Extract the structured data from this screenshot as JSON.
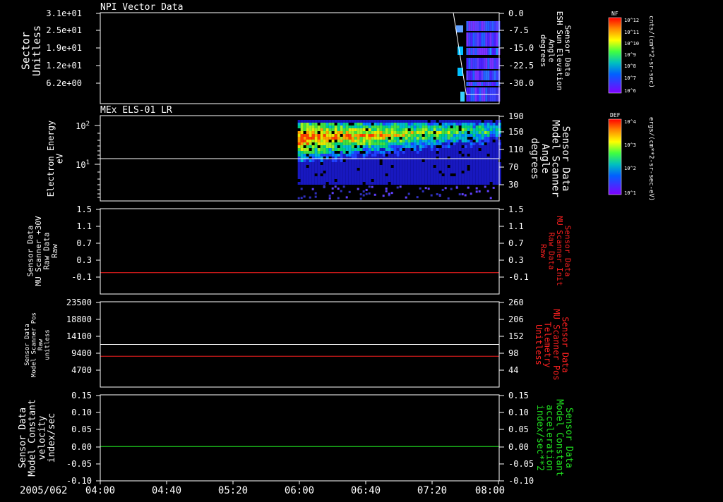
{
  "chart_data": [
    {
      "type": "heatmap",
      "title": "NPI Vector Data",
      "ylabel": "Sector\nUnitless",
      "yticks": [
        "3.1e+01",
        "2.5e+01",
        "1.9e+01",
        "1.2e+01",
        "6.2e+00"
      ],
      "y2label": "Sensor Data\nESH Sun Elevation\nAngle\ndegrees",
      "y2ticks": [
        "0.0",
        "-7.5",
        "-15.0",
        "-22.5",
        "-30.0"
      ],
      "y2lim": [
        -34.5,
        0
      ],
      "colorbar_label": "NF",
      "colorbar_units": "cnts/(cm**2-sr-sec)",
      "colorbar_ticks": [
        "10^12",
        "10^11",
        "10^10",
        "10^9",
        "10^8",
        "10^7",
        "10^6"
      ],
      "angle_series": {
        "x": [
          0,
          3.54,
          3.67,
          4.0
        ],
        "y": [
          0,
          0,
          -31,
          -31
        ]
      },
      "data_start_hour": 3.67
    },
    {
      "type": "heatmap",
      "title": "MEx ELS-01 LR",
      "ylabel": "Electron Energy\neV",
      "yticks": [
        "10^2",
        "10^1"
      ],
      "y2label": "Sensor Data\nModel Scanner\nAngle\ndegrees",
      "y2ticks": [
        "190",
        "150",
        "110",
        "70",
        "30"
      ],
      "y2lim": [
        0,
        190
      ],
      "colorbar_label": "DEF",
      "colorbar_units": "ergs/(cm**2-sr-sec-eV)",
      "colorbar_ticks": [
        "10^4",
        "10^3",
        "10^2",
        "10^1"
      ],
      "angle_series": {
        "x": [
          0,
          4.0
        ],
        "y": [
          90,
          90
        ]
      },
      "data_start_hour": 1.98
    },
    {
      "type": "line",
      "ylabel": "Sensor Data\nMU Scanner +30V\nRaw Data\nRaw",
      "yticks": [
        "1.5",
        "1.1",
        "0.7",
        "0.3",
        "-0.1"
      ],
      "ylim": [
        -0.5,
        1.5
      ],
      "y2label": "Sensor Data\nMU Scanner Init\nRaw Data\nRaw",
      "y2ticks": [
        "1.5",
        "1.1",
        "0.7",
        "0.3",
        "-0.1"
      ],
      "series": [
        {
          "values": [
            0,
            0
          ],
          "color": "#ff2020"
        }
      ]
    },
    {
      "type": "line",
      "ylabel": "Sensor Data\nModel Scanner Pos\nRaw\nunitless",
      "yticks": [
        "23500",
        "18800",
        "14100",
        "9400",
        "4700"
      ],
      "ylim": [
        0,
        23500
      ],
      "y2label": "Sensor Data\nMU Scanner Pos\nTelemetry\nUnitless",
      "y2ticks": [
        "260",
        "206",
        "152",
        "98",
        "44"
      ],
      "y2lim": [
        0,
        260
      ],
      "series": [
        {
          "values": [
            11750,
            11750
          ],
          "color": "#ffffff"
        },
        {
          "values": [
            8500,
            8500
          ],
          "color": "#ff2020"
        }
      ]
    },
    {
      "type": "line",
      "ylabel": "Sensor Data\nModel Constant\nvelocity\nindex/sec",
      "yticks": [
        "0.15",
        "0.10",
        "0.05",
        "0.00",
        "-0.05",
        "-0.10"
      ],
      "ylim": [
        -0.1,
        0.15
      ],
      "y2label": "Sensor Data\nModel Constant\nacceleration\nindex/sec**2",
      "y2ticks": [
        "0.15",
        "0.10",
        "0.05",
        "0.00",
        "-0.05",
        "-0.10"
      ],
      "series": [
        {
          "values": [
            0,
            0
          ],
          "color": "#20e020"
        }
      ]
    }
  ],
  "x_axis": {
    "date_label": "2005/062",
    "ticks": [
      "04:00",
      "04:40",
      "05:20",
      "06:00",
      "06:40",
      "07:20",
      "08:00"
    ],
    "range": [
      "04:00",
      "08:00"
    ]
  },
  "colors": {
    "background": "#000000",
    "axis": "#ffffff",
    "red": "#ff2020",
    "green": "#20e020"
  }
}
